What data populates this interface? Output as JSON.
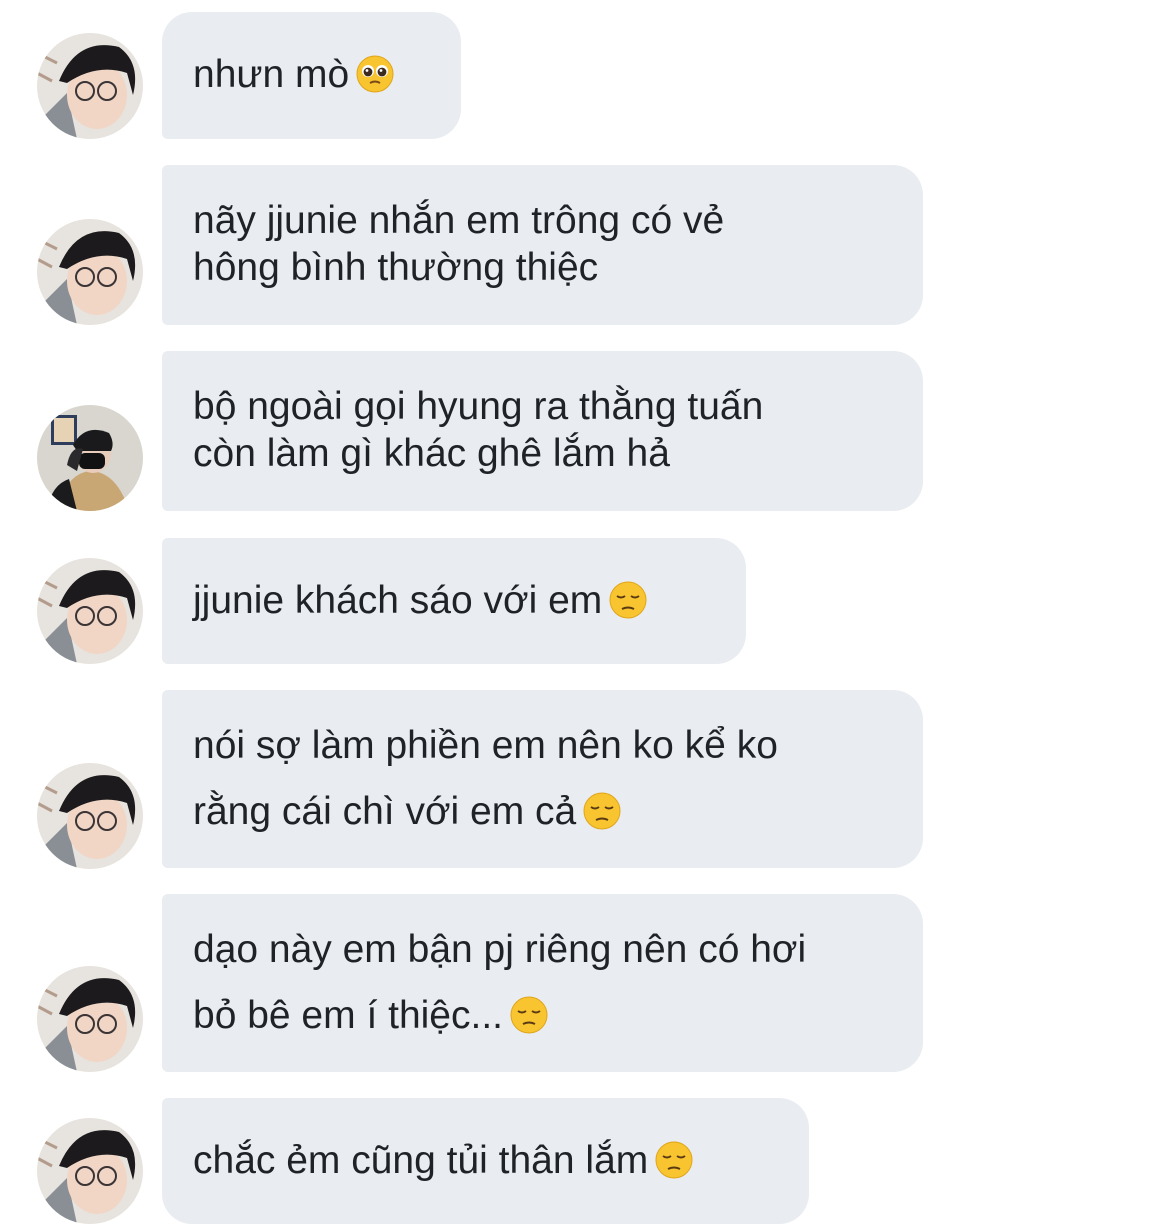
{
  "conversation": {
    "messages": [
      {
        "sender": "avatar-boy-glasses",
        "lines": [
          "nhưn mò"
        ],
        "emoji": "pleading-face-emoji"
      },
      {
        "sender": "avatar-boy-glasses",
        "lines": [
          "nãy jjunie nhắn em trông có vẻ",
          "hông bình thường thiệc"
        ],
        "emoji": null
      },
      {
        "sender": "avatar-masked",
        "lines": [
          "bộ ngoài gọi hyung ra thằng tuấn",
          "còn làm gì khác ghê lắm hả"
        ],
        "emoji": null
      },
      {
        "sender": "avatar-boy-glasses",
        "lines": [
          "jjunie khách sáo với em"
        ],
        "emoji": "pensive-face-emoji"
      },
      {
        "sender": "avatar-boy-glasses",
        "lines": [
          "nói sợ làm phiền em nên ko kể ko",
          "rằng cái chì với em cả"
        ],
        "emoji": "pensive-face-emoji"
      },
      {
        "sender": "avatar-boy-glasses",
        "lines": [
          "dạo này em bận pj riêng nên có hơi",
          "bỏ bê em í thiệc..."
        ],
        "emoji": "pensive-face-emoji"
      },
      {
        "sender": "avatar-boy-glasses",
        "lines": [
          "chắc ẻm cũng tủi thân lắm"
        ],
        "emoji": "pensive-face-emoji"
      }
    ]
  },
  "colors": {
    "bubble_background": "#e9ecf0",
    "text": "#1f2328",
    "page_background": "#ffffff"
  }
}
